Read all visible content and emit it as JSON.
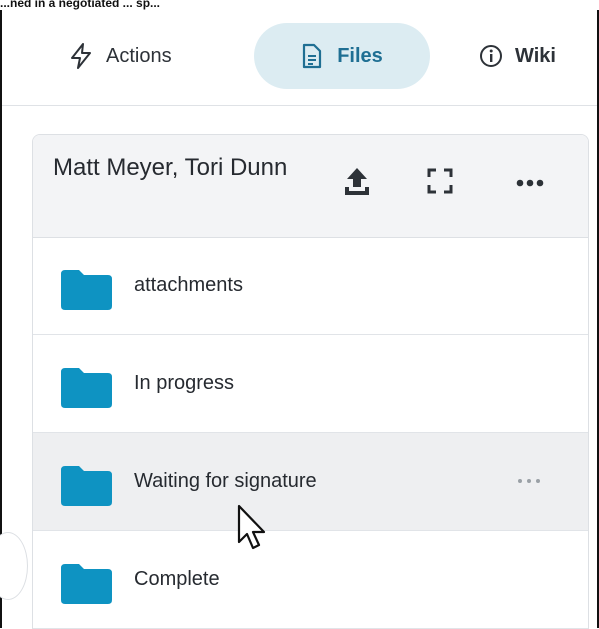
{
  "caption": "...ned in a negotiated ... sp...",
  "tabs": [
    {
      "label": "Actions",
      "icon": "lightning-icon",
      "active": false
    },
    {
      "label": "Files",
      "icon": "file-icon",
      "active": true
    },
    {
      "label": "Wiki",
      "icon": "info-icon",
      "active": false
    }
  ],
  "panel": {
    "title": "Matt Meyer, Tori Dunn",
    "actions": [
      "upload-icon",
      "expand-icon",
      "more-icon"
    ]
  },
  "folders": [
    {
      "label": "attachments",
      "icon": "folder-icon"
    },
    {
      "label": "In progress",
      "icon": "folder-icon"
    },
    {
      "label": "Waiting for signature",
      "icon": "folder-icon"
    },
    {
      "label": "Complete",
      "icon": "folder-icon"
    }
  ],
  "colors": {
    "accent": "#1f6f93",
    "folder": "#0e93c2",
    "active_tab_bg": "#dcecf2",
    "header_bg": "#f3f4f6",
    "hover_row": "#eeeff1"
  }
}
